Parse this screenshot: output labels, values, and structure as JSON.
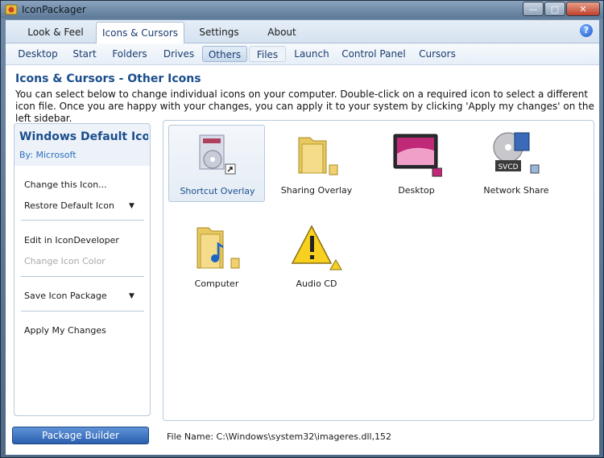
{
  "window": {
    "title": "IconPackager"
  },
  "main_tabs": [
    {
      "label": "Look & Feel"
    },
    {
      "label": "Icons & Cursors"
    },
    {
      "label": "Settings"
    },
    {
      "label": "About"
    }
  ],
  "sub_tabs": [
    {
      "label": "Desktop"
    },
    {
      "label": "Start"
    },
    {
      "label": "Folders"
    },
    {
      "label": "Drives"
    },
    {
      "label": "Others"
    },
    {
      "label": "Files"
    },
    {
      "label": "Launch"
    },
    {
      "label": "Control Panel"
    },
    {
      "label": "Cursors"
    }
  ],
  "page": {
    "heading": "Icons & Cursors - Other Icons",
    "description": "You can select below to change individual icons on your computer. Double-click on a required icon to select a different icon file. Once you are happy with your changes, you can apply it to your system by clicking 'Apply my changes' on the left sidebar."
  },
  "sidebar": {
    "package_title": "Windows Default Ico...",
    "author": "By: Microsoft",
    "items": [
      {
        "label": "Change this Icon..."
      },
      {
        "label": "Restore Default Icon"
      },
      {
        "label": "Edit in IconDeveloper"
      },
      {
        "label": "Change Icon Color"
      },
      {
        "label": "Save Icon Package"
      },
      {
        "label": "Apply My Changes"
      }
    ]
  },
  "icons": [
    {
      "label": "Shortcut Overlay",
      "icon": "shortcut-overlay-icon"
    },
    {
      "label": "Sharing Overlay",
      "icon": "sharing-overlay-icon"
    },
    {
      "label": "Desktop",
      "icon": "desktop-icon"
    },
    {
      "label": "Network Share",
      "icon": "network-share-icon",
      "badge_text": "SVCD"
    },
    {
      "label": "Computer",
      "icon": "computer-icon"
    },
    {
      "label": "Audio CD",
      "icon": "audio-cd-icon"
    }
  ],
  "footer": {
    "package_builder": "Package Builder",
    "file_name": "File Name: C:\\Windows\\system32\\imageres.dll,152"
  }
}
